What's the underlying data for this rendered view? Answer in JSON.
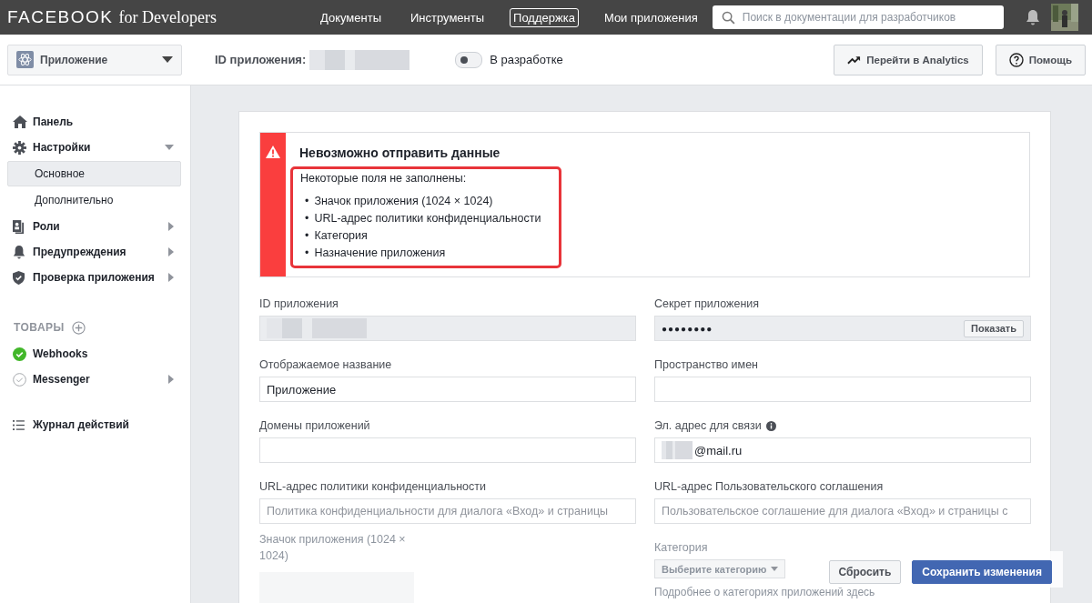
{
  "header": {
    "logo_main": "FACEBOOK",
    "logo_sub": "for Developers",
    "nav": [
      {
        "label": "Документы",
        "selected": false
      },
      {
        "label": "Инструменты",
        "selected": false
      },
      {
        "label": "Поддержка",
        "selected": true
      },
      {
        "label": "Мои приложения",
        "selected": false
      }
    ],
    "search": {
      "placeholder": "Поиск в документации для разработчиков"
    }
  },
  "app_bar": {
    "app_selector": "Приложение",
    "id_label": "ID приложения:",
    "dev_mode": {
      "label": "В разработке",
      "on": false
    },
    "buttons": [
      {
        "kind": "analytics",
        "label": "Перейти в Analytics"
      },
      {
        "kind": "help",
        "label": "Помощь"
      }
    ]
  },
  "sidebar": {
    "items": [
      {
        "label": "Панель"
      },
      {
        "label": "Настройки",
        "expanded": true,
        "children": [
          {
            "label": "Основное",
            "selected": true
          },
          {
            "label": "Дополнительно",
            "selected": false
          }
        ]
      },
      {
        "label": "Роли",
        "expanded": false
      },
      {
        "label": "Предупреждения",
        "expanded": false
      },
      {
        "label": "Проверка приложения",
        "expanded": false
      }
    ],
    "products_title": "ТОВАРЫ",
    "products": [
      {
        "label": "Webhooks",
        "checked": true
      },
      {
        "label": "Messenger",
        "checked": false,
        "expanded": false
      }
    ],
    "activity_log": "Журнал действий"
  },
  "error": {
    "title": "Невозможно отправить данные",
    "intro": "Некоторые поля не заполнены:",
    "items": [
      {
        "bullet": "•",
        "text": "Значок приложения (1024 × 1024)"
      },
      {
        "bullet": "•",
        "text": "URL-адрес политики конфиденциальности"
      },
      {
        "bullet": "•",
        "text": "Категория"
      },
      {
        "bullet": "•",
        "text": "Назначение приложения"
      }
    ]
  },
  "fields": [
    {
      "label": "ID приложения",
      "kind": "redacted"
    },
    {
      "label": "Секрет приложения",
      "kind": "secret",
      "value": "●●●●●●●●",
      "button": "Показать"
    },
    {
      "label": "Отображаемое название",
      "kind": "text",
      "value": "Приложение"
    },
    {
      "label": "Пространство имен",
      "kind": "text"
    },
    {
      "label": "Домены приложений",
      "kind": "text"
    },
    {
      "label": "Эл. адрес для связи",
      "kind": "email",
      "info": true,
      "value": "@mail.ru"
    },
    {
      "label": "URL-адрес политики конфиденциальности",
      "kind": "text",
      "placeholder": "Политика конфиденциальности для диалога «Вход» и страницы"
    },
    {
      "label": "URL-адрес Пользовательского соглашения",
      "kind": "text",
      "placeholder": "Пользовательское соглашение для диалога «Вход» и страницы с"
    },
    {
      "label": "Значок приложения (1024 × 1024)",
      "kind": "upload"
    },
    {
      "label": "Категория",
      "kind": "select",
      "placeholder": "Выберите категорию",
      "hint": "Подробнее о категориях приложений здесь"
    }
  ],
  "footer": {
    "buttons": [
      {
        "kind": "secondary",
        "label": "Сбросить"
      },
      {
        "kind": "primary",
        "label": "Сохранить изменения"
      }
    ]
  }
}
